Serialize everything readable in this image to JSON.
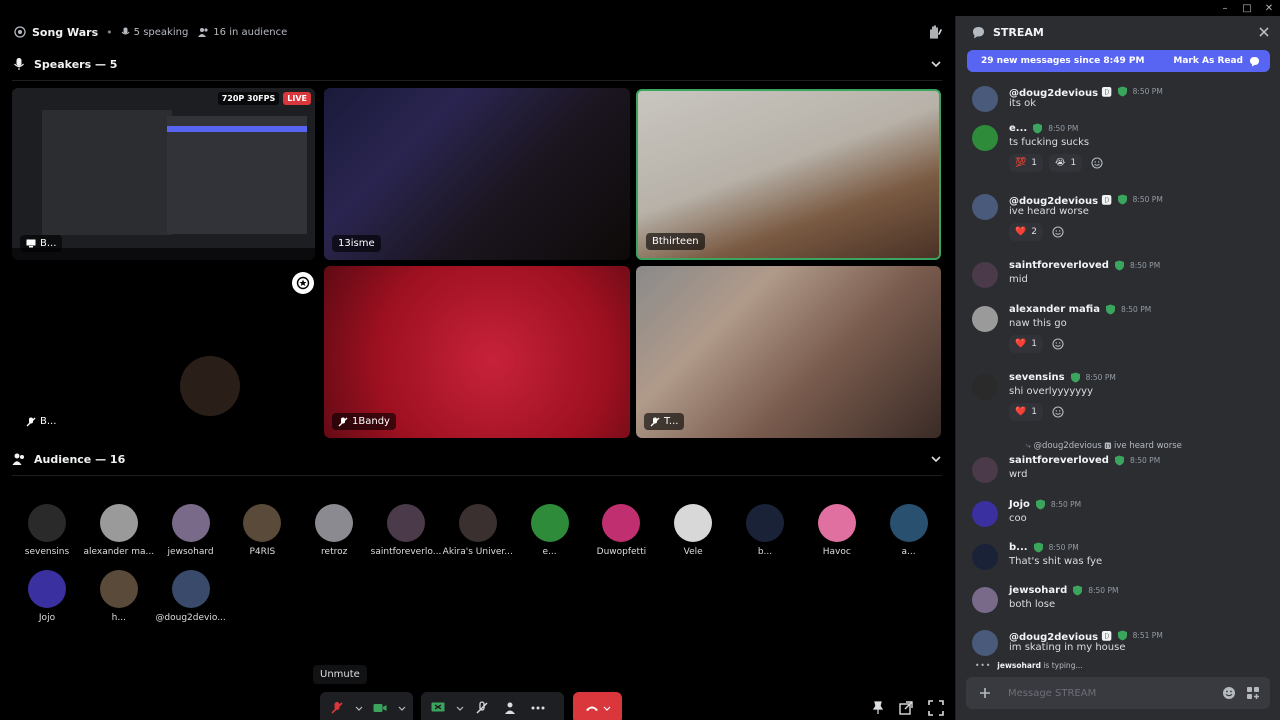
{
  "window": {
    "minimize": "–",
    "maximize": "□",
    "close": "✕"
  },
  "topbar": {
    "title": "Song Wars",
    "dot": "•",
    "speaking": "5 speaking",
    "audience": "16 in audience"
  },
  "speakers": {
    "header": "Speakers — 5"
  },
  "tiles": {
    "t1_badge_quality": "720P 30FPS",
    "t1_badge_live": "LIVE",
    "t1_label": "B...",
    "t2_label": "13isme",
    "t3_label": "Bthirteen",
    "t4_label": "B...",
    "t5_label": "1Bandy",
    "t6_label": "T..."
  },
  "audience": {
    "header": "Audience — 16",
    "members": [
      {
        "name": "sevensins",
        "color": "#2a2a2a"
      },
      {
        "name": "alexander ma...",
        "color": "#9a9a9a"
      },
      {
        "name": "jewsohard",
        "color": "#7a6a8a"
      },
      {
        "name": "P4RIS",
        "color": "#5a4a3a"
      },
      {
        "name": "retroz",
        "color": "#8a8a90"
      },
      {
        "name": "saintforeverlo...",
        "color": "#4a3a4a"
      },
      {
        "name": "Akira's Univer...",
        "color": "#3a3030"
      },
      {
        "name": "e...",
        "color": "#2e8b3a"
      },
      {
        "name": "Duwopfetti",
        "color": "#c03070"
      },
      {
        "name": "Vele",
        "color": "#d8d8d8"
      },
      {
        "name": "b...",
        "color": "#1a2238"
      },
      {
        "name": "Havoc",
        "color": "#e070a0"
      },
      {
        "name": "a...",
        "color": "#2a5070"
      },
      {
        "name": "Jojo",
        "color": "#3a30a0"
      },
      {
        "name": "h...",
        "color": "#5a4a3a"
      },
      {
        "name": "@doug2devio...",
        "color": "#3a4a6a"
      }
    ]
  },
  "controls": {
    "tooltip": "Unmute"
  },
  "chat": {
    "title": "STREAM",
    "new_messages": "29 new messages since 8:49 PM",
    "mark_read": "Mark As Read",
    "reply_preview": "@doug2devious 🅳 ive heard worse",
    "typing_user": "jewsohard",
    "typing_suffix": " is typing...",
    "input_placeholder": "Message STREAM",
    "messages": [
      {
        "author": "@doug2devious 🅳",
        "time": "8:50 PM",
        "text": "its ok",
        "avatar": "#4a5a7a"
      },
      {
        "author": "e...",
        "time": "8:50 PM",
        "text": "ts fucking sucks",
        "avatar": "#2e8b3a",
        "r1_emoji": "💯",
        "r1_count": "1",
        "r2_emoji": "😭",
        "r2_count": "1"
      },
      {
        "author": "@doug2devious 🅳",
        "time": "8:50 PM",
        "text": "ive heard worse",
        "avatar": "#4a5a7a",
        "r1_emoji": "❤️",
        "r1_count": "2"
      },
      {
        "author": "saintforeverloved",
        "time": "8:50 PM",
        "text": "mid",
        "avatar": "#4a3a4a"
      },
      {
        "author": "alexander mafia",
        "time": "8:50 PM",
        "text": "naw this go",
        "avatar": "#9a9a9a",
        "r1_emoji": "❤️",
        "r1_count": "1"
      },
      {
        "author": "sevensins",
        "time": "8:50 PM",
        "text": "shi overlyyyyyyy",
        "avatar": "#2a2a2a",
        "r1_emoji": "❤️",
        "r1_count": "1"
      },
      {
        "author": "saintforeverloved",
        "time": "8:50 PM",
        "text": "wrd",
        "avatar": "#4a3a4a"
      },
      {
        "author": "Jojo",
        "time": "8:50 PM",
        "text": "coo",
        "avatar": "#3a30a0"
      },
      {
        "author": "b...",
        "time": "8:50 PM",
        "text": "That's shit was fye",
        "avatar": "#1a2238"
      },
      {
        "author": "jewsohard",
        "time": "8:50 PM",
        "text": "both lose",
        "avatar": "#7a6a8a"
      },
      {
        "author": "@doug2devious 🅳",
        "time": "8:51 PM",
        "text": "im skating in my house",
        "avatar": "#4a5a7a"
      }
    ]
  }
}
